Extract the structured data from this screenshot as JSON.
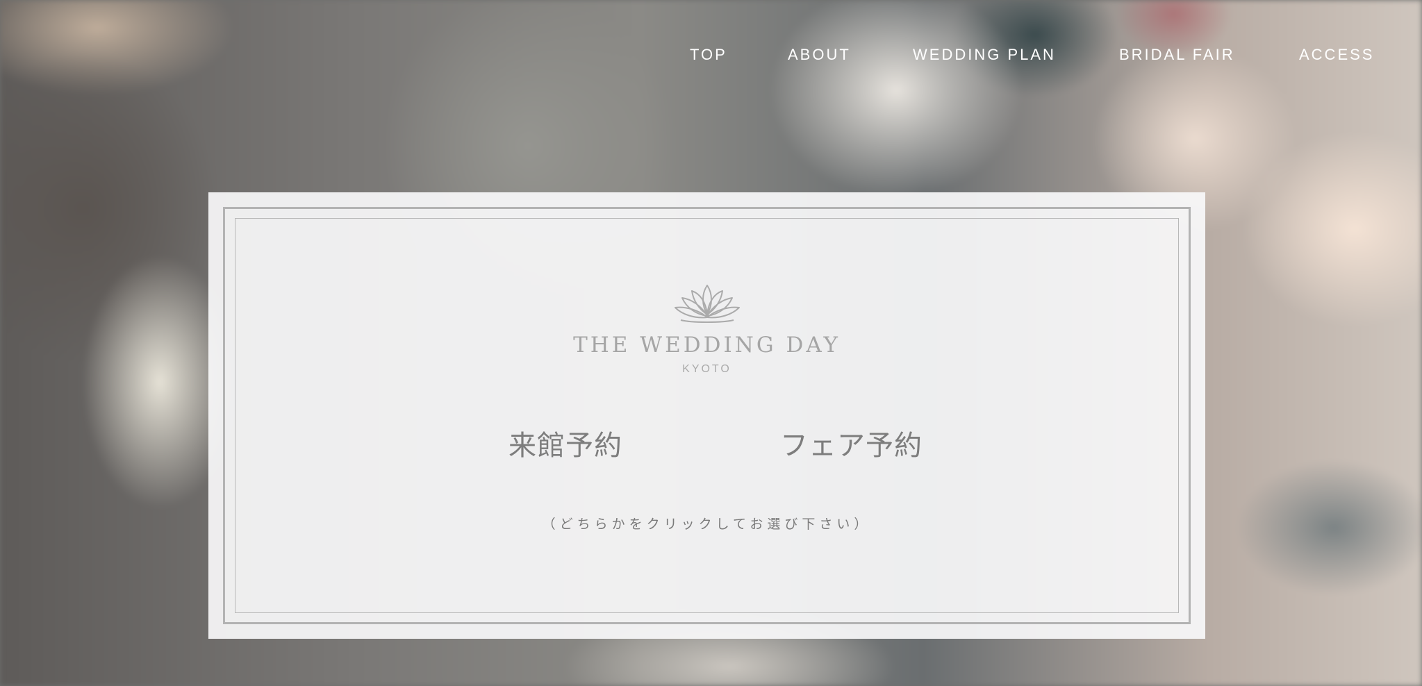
{
  "nav": {
    "items": [
      {
        "label": "TOP"
      },
      {
        "label": "ABOUT"
      },
      {
        "label": "WEDDING PLAN"
      },
      {
        "label": "BRIDAL FAIR"
      },
      {
        "label": "ACCESS"
      }
    ]
  },
  "logo": {
    "icon": "lotus-icon",
    "title": "THE WEDDING DAY",
    "subtitle": "KYOTO"
  },
  "choices": {
    "visit": "来館予約",
    "fair": "フェア予約"
  },
  "note": "（どちらかをクリックしてお選び下さい）",
  "colors": {
    "frame": "#b3b3b3",
    "choice_text": "#7d7d7d",
    "logo_text": "#a5a5a5",
    "nav_text": "#ffffff"
  }
}
